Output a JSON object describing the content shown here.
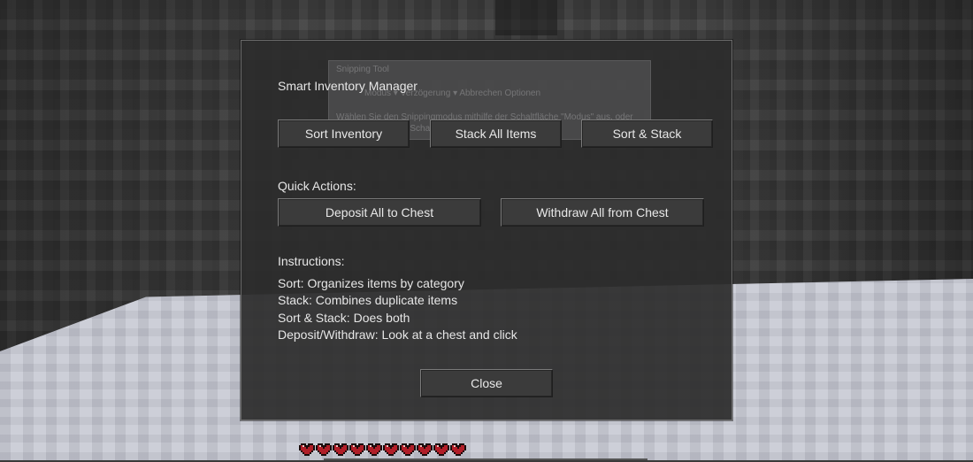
{
  "panel": {
    "title": "Smart Inventory Manager",
    "buttons": {
      "sort": "Sort Inventory",
      "stack": "Stack All Items",
      "sort_stack": "Sort & Stack"
    },
    "quick_actions": {
      "label": "Quick Actions:",
      "deposit": "Deposit All to Chest",
      "withdraw": "Withdraw All from Chest"
    },
    "instructions": {
      "label": "Instructions:",
      "lines": [
        "Sort: Organizes items by category",
        "Stack: Combines duplicate items",
        "Sort & Stack: Does both",
        "Deposit/Withdraw: Look at a chest and click"
      ]
    },
    "close": "Close"
  },
  "ghost_overlay": {
    "title": "Snipping Tool",
    "toolbar": "Modus  ▾   Verzögerung  ▾   Abbrechen   Optionen",
    "hint_line_1": "Wählen Sie den Snippingmodus mithilfe der Schaltfläche \"Modus\" aus, oder",
    "hint_line_2": "klicken Sie auf die Schaltfläche \"Neu\"."
  },
  "hud": {
    "hearts": 10,
    "heart_color": "#b01e28"
  }
}
